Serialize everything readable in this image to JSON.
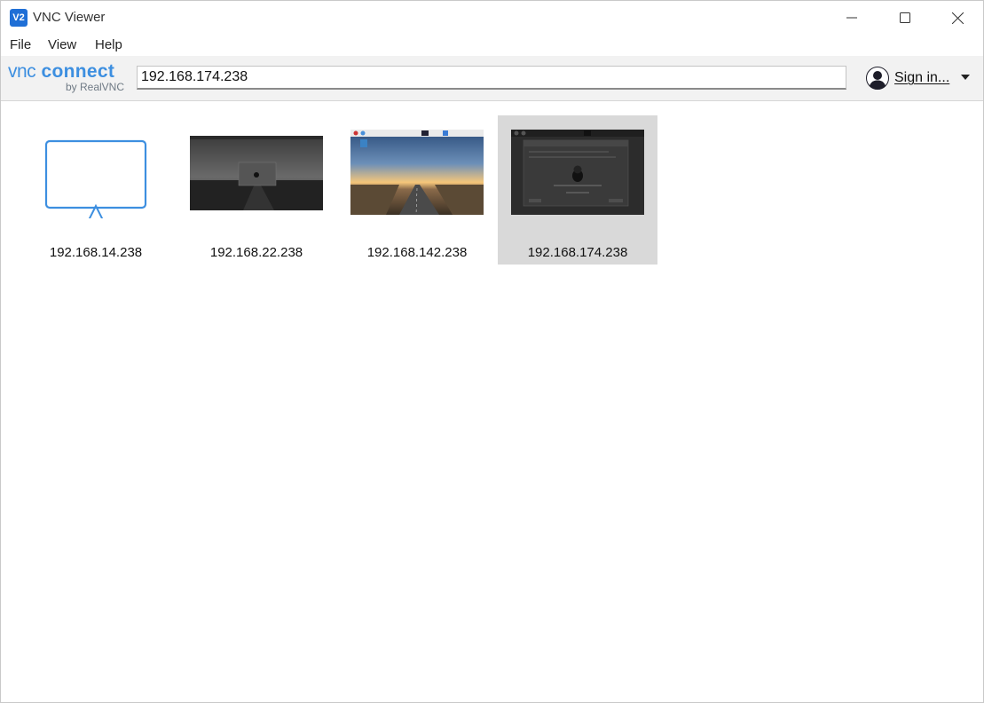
{
  "window": {
    "title": "VNC Viewer",
    "icon_text": "V2"
  },
  "menu": [
    "File",
    "View",
    "Help"
  ],
  "toolbar": {
    "logo_main_vnc": "vnc",
    "logo_main_connect": "connect",
    "logo_sub": "by RealVNC",
    "address_value": "192.168.174.238",
    "signin_label": "Sign in..."
  },
  "connections": [
    {
      "label": "192.168.14.238",
      "thumbnail": "monitor-icon",
      "selected": false
    },
    {
      "label": "192.168.22.238",
      "thumbnail": "dark-desktop-screenshot",
      "selected": false
    },
    {
      "label": "192.168.142.238",
      "thumbnail": "road-sunset-desktop-screenshot",
      "selected": false
    },
    {
      "label": "192.168.174.238",
      "thumbnail": "setup-dialog-desktop-screenshot",
      "selected": true
    }
  ],
  "colors": {
    "accent": "#3d8fe0",
    "selection": "#d9d9d9",
    "toolbar_bg": "#f2f2f2"
  }
}
